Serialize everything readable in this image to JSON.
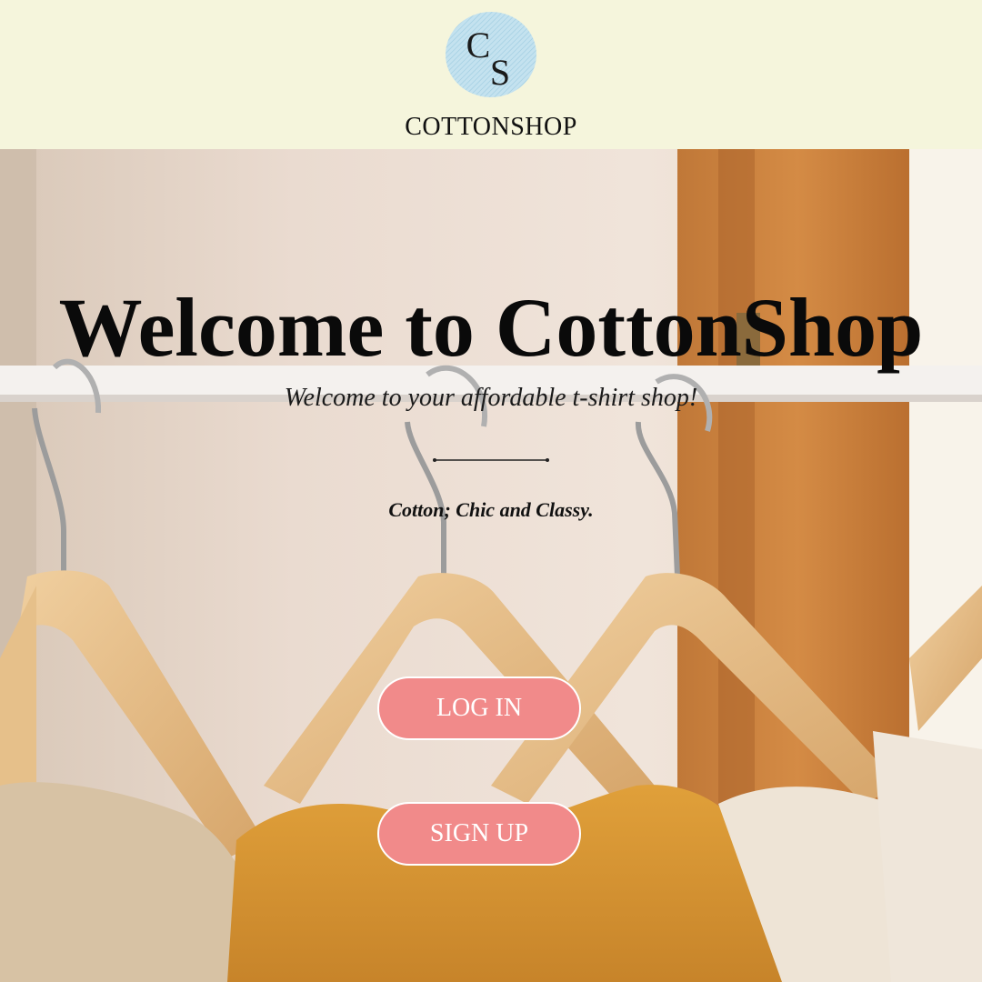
{
  "header": {
    "logo_text": "CS",
    "brand_name": "COTTONSHOP"
  },
  "hero": {
    "title": "Welcome to CottonShop",
    "subtitle": "Welcome to your affordable t-shirt shop!",
    "tagline": "Cotton; Chic and Classy.",
    "login_label": "LOG IN",
    "signup_label": "SIGN UP"
  },
  "colors": {
    "header_bg": "#f5f5dc",
    "logo_circle": "#b7dcec",
    "button_bg": "#f18a8a",
    "button_text": "#ffffff"
  }
}
